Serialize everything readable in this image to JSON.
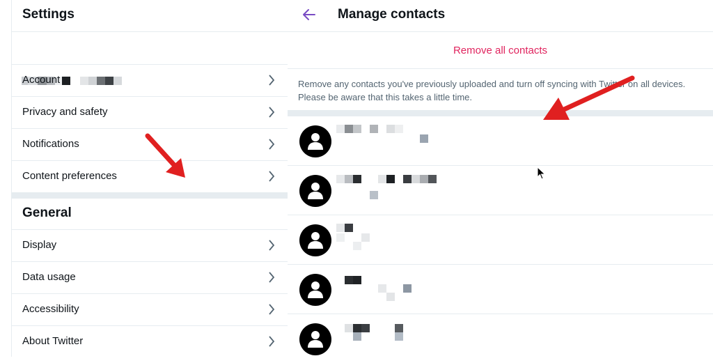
{
  "settings": {
    "title": "Settings",
    "account_items": [
      {
        "label": "Account"
      },
      {
        "label": "Privacy and safety"
      },
      {
        "label": "Notifications"
      },
      {
        "label": "Content preferences"
      }
    ],
    "general_title": "General",
    "general_items": [
      {
        "label": "Display"
      },
      {
        "label": "Data usage"
      },
      {
        "label": "Accessibility"
      },
      {
        "label": "About Twitter"
      }
    ]
  },
  "manage": {
    "title": "Manage contacts",
    "remove_all_label": "Remove all contacts",
    "description": "Remove any contacts you've previously uploaded and turn off syncing with Twitter on all devices. Please be aware that this takes a little time."
  },
  "icons": {
    "back": "back-arrow-icon",
    "chevron": "chevron-right-icon",
    "avatar": "default-avatar-icon"
  },
  "colors": {
    "accent": "#794bc4",
    "danger": "#e0245e",
    "divider": "#e6ecf0",
    "annotation_arrow": "#e02020"
  }
}
